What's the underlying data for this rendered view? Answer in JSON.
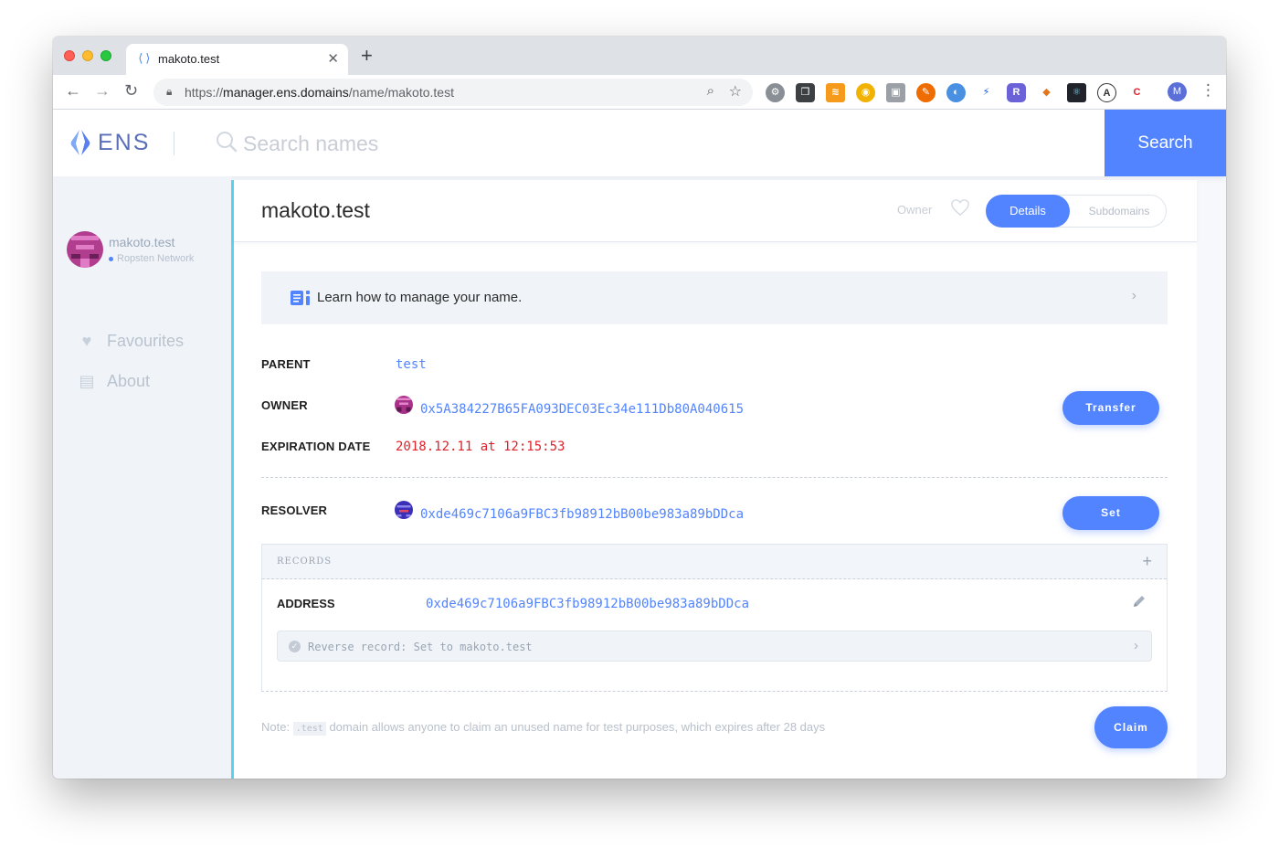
{
  "browser": {
    "tab_title": "makoto.test",
    "tab_favicon": "⟨⟩",
    "tab_close": "✕",
    "new_tab": "+",
    "url_prefix": "https://",
    "url_host": "manager.ens.domains",
    "url_path": "/name/makoto.test",
    "profile_initial": "M"
  },
  "header": {
    "logo_text": "ENS",
    "search_placeholder": "Search names",
    "search_button": "Search"
  },
  "sidebar": {
    "account_name": "makoto.test",
    "network": "Ropsten Network",
    "items": [
      {
        "label": "Favourites",
        "icon": "heart-icon"
      },
      {
        "label": "About",
        "icon": "chat-icon"
      }
    ]
  },
  "main": {
    "domain": "makoto.test",
    "owner_label": "Owner",
    "tabs": {
      "details": "Details",
      "subdomains": "Subdomains"
    },
    "learn_text": "Learn how to manage your name.",
    "parent_label": "PARENT",
    "parent_value": "test",
    "owner_row_label": "OWNER",
    "owner_value": "0x5A384227B65FA093DEC03Ec34e111Db80A040615",
    "transfer_button": "Transfer",
    "expiration_label": "EXPIRATION DATE",
    "expiration_value": "2018.12.11 at 12:15:53",
    "resolver_label": "RESOLVER",
    "resolver_value": "0xde469c7106a9FBC3fb98912bB00be983a89bDDca",
    "set_button": "Set",
    "records_title": "RECORDS",
    "address_label": "ADDRESS",
    "address_value": "0xde469c7106a9FBC3fb98912bB00be983a89bDDca",
    "reverse_record": "Reverse record: Set to makoto.test",
    "note_prefix": "Note:",
    "note_code": ".test",
    "note_suffix": "domain allows anyone to claim an unused name for test purposes, which expires after 28 days",
    "claim_button": "Claim"
  },
  "colors": {
    "accent": "#5284ff",
    "sidebar_accent": "#5cd2ee",
    "expiry_red": "#e0202a"
  }
}
